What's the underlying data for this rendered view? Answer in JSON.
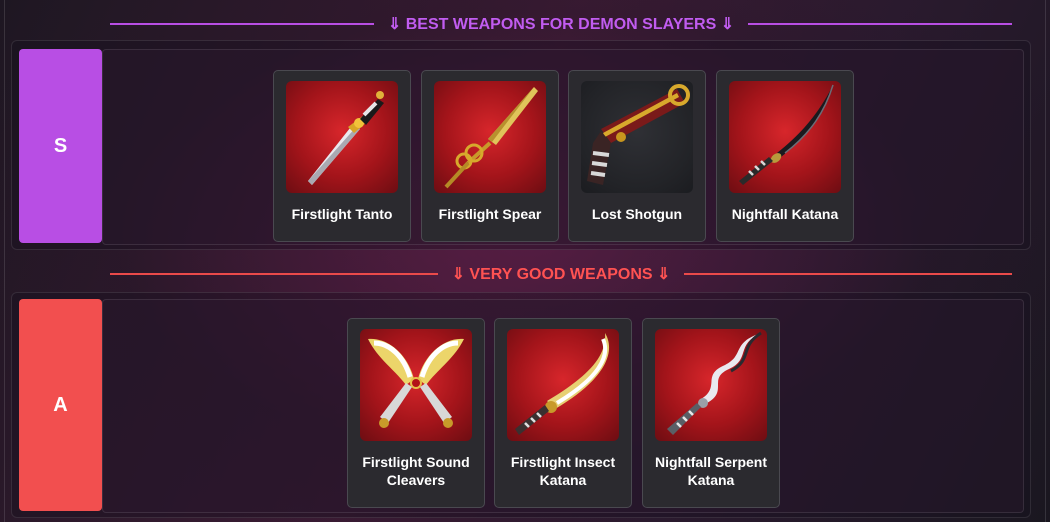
{
  "tiers": [
    {
      "header": "⇓ BEST WEAPONS FOR DEMON SLAYERS ⇓",
      "label": "S",
      "color": "#b84ee4",
      "items": [
        {
          "name": "Firstlight Tanto",
          "icon": "tanto-icon"
        },
        {
          "name": "Firstlight Spear",
          "icon": "spear-icon"
        },
        {
          "name": "Lost Shotgun",
          "icon": "shotgun-icon"
        },
        {
          "name": "Nightfall Katana",
          "icon": "katana-icon"
        }
      ]
    },
    {
      "header": "⇓ VERY GOOD WEAPONS ⇓",
      "label": "A",
      "color": "#f24f4f",
      "items": [
        {
          "name": "Firstlight Sound Cleavers",
          "icon": "cleavers-icon"
        },
        {
          "name": "Firstlight Insect Katana",
          "icon": "insect-katana-icon"
        },
        {
          "name": "Nightfall Serpent Katana",
          "icon": "serpent-katana-icon"
        }
      ]
    }
  ]
}
